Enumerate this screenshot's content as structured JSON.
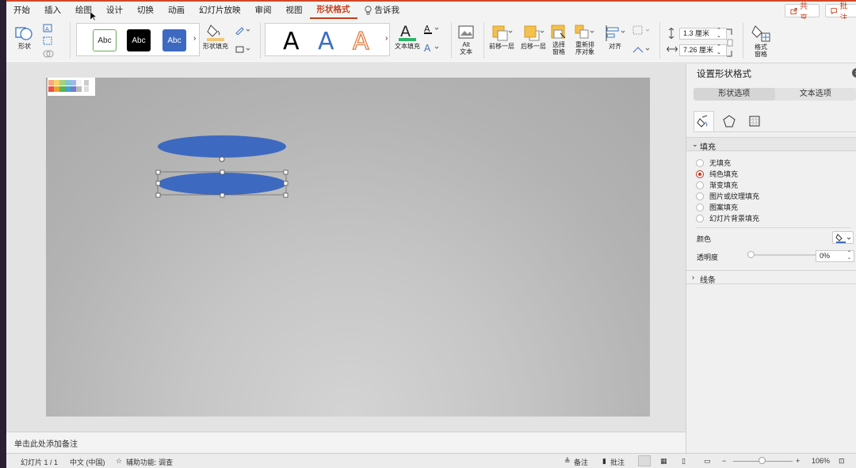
{
  "menu": {
    "tabs": [
      "开始",
      "插入",
      "绘图",
      "设计",
      "切换",
      "动画",
      "幻灯片放映",
      "审阅",
      "视图",
      "形状格式"
    ],
    "active_tab": "形状格式",
    "tell_me": "告诉我",
    "share": "共享",
    "comments": "批注"
  },
  "ribbon": {
    "shapes_label": "形状",
    "style_label": "Abc",
    "shape_fill_label": "形状填充",
    "wordart_letter": "A",
    "text_fill_label": "文本填充",
    "alt_text_label": "Alt\n文本",
    "bring_forward": "前移一层",
    "send_backward": "后移一层",
    "selection_pane": "选择\n窗格",
    "reorder": "重新排\n序对象",
    "align": "对齐",
    "height_value": "1.3 厘米",
    "width_value": "7.26 厘米",
    "format_pane": "格式\n窗格"
  },
  "canvas": {
    "notes_placeholder": "单击此处添加备注"
  },
  "format_pane": {
    "title": "设置形状格式",
    "tab_shape": "形状选项",
    "tab_text": "文本选项",
    "fill_header": "填充",
    "fill_options": [
      "无填充",
      "纯色填充",
      "渐变填充",
      "图片或纹理填充",
      "图案填充",
      "幻灯片背景填充"
    ],
    "selected_fill": "纯色填充",
    "color_label": "颜色",
    "transparency_label": "透明度",
    "transparency_value": "0%",
    "line_header": "线条"
  },
  "status": {
    "slide_count": "幻灯片 1 / 1",
    "language": "中文 (中国)",
    "accessibility": "辅助功能: 调查",
    "notes": "备注",
    "comments": "批注",
    "zoom": "106%"
  },
  "colors": {
    "accent": "#c43e1c",
    "shape_fill": "#3e69c0"
  }
}
